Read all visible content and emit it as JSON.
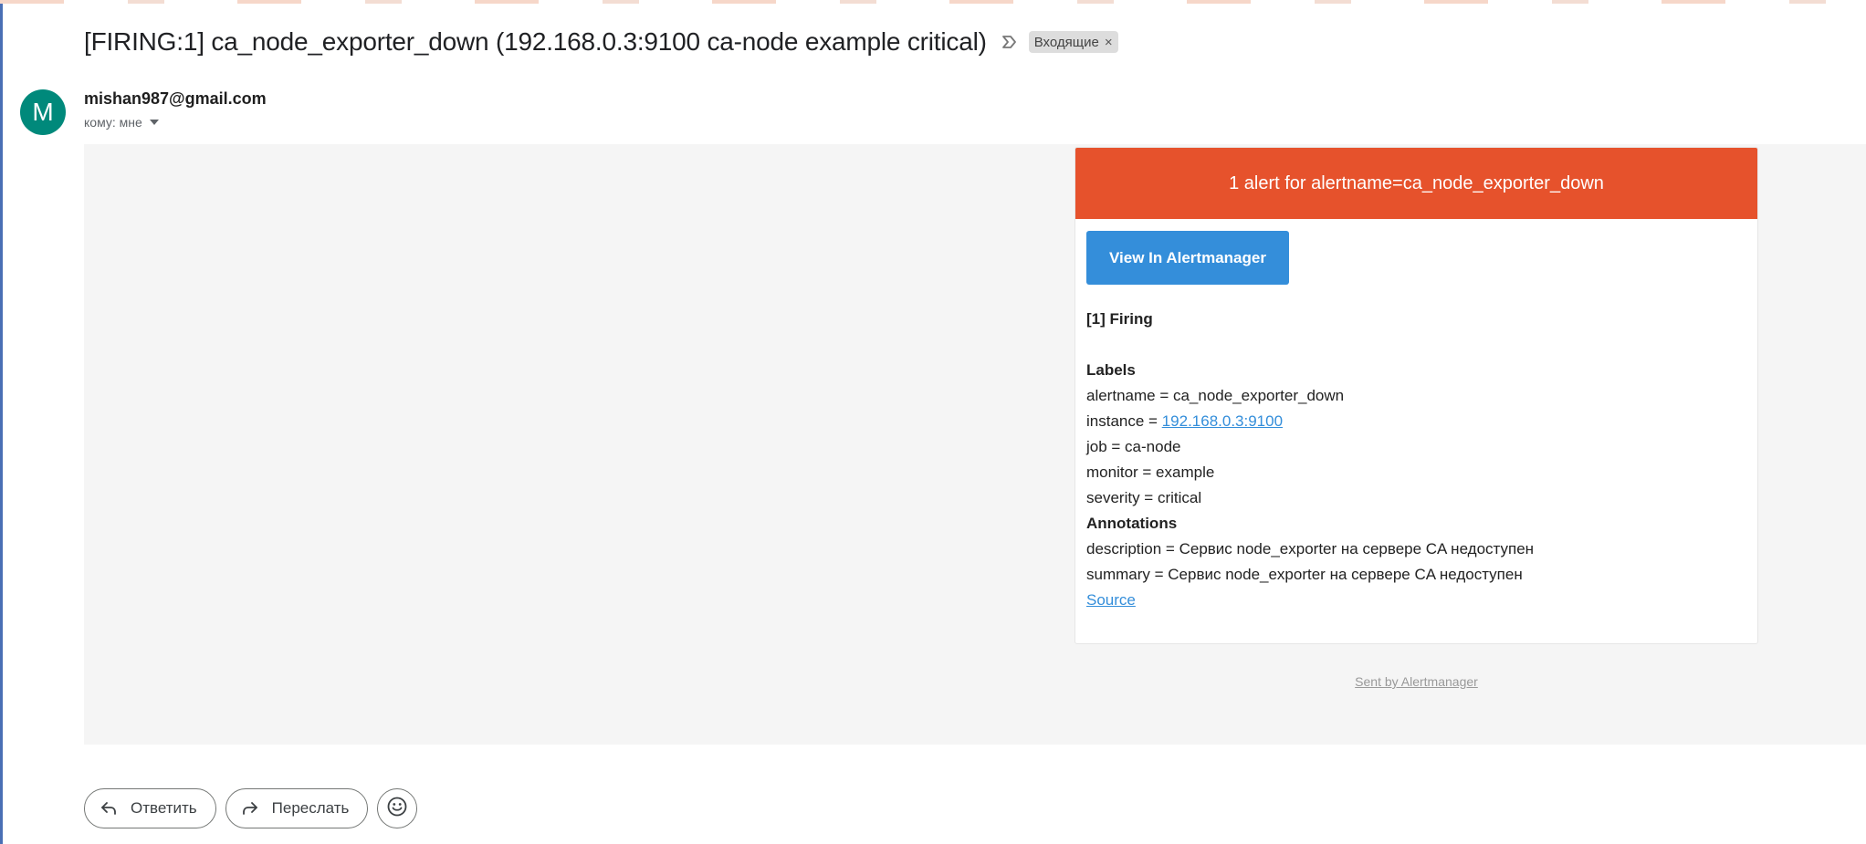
{
  "email": {
    "subject": "[FIRING:1] ca_node_exporter_down (192.168.0.3:9100 ca-node example critical)",
    "label_chip": "Входящие",
    "label_chip_close": "×",
    "sender": "mishan987@gmail.com",
    "avatar_letter": "M",
    "recipient": "кому: мне"
  },
  "alert": {
    "header": "1 alert for alertname=ca_node_exporter_down",
    "button": "View In Alertmanager",
    "firing": "[1] Firing",
    "labels_title": "Labels",
    "labels": {
      "alertname": "alertname = ca_node_exporter_down",
      "instance_prefix": "instance = ",
      "instance_link": "192.168.0.3:9100",
      "job": "job = ca-node",
      "monitor": "monitor = example",
      "severity": "severity = critical"
    },
    "annotations_title": "Annotations",
    "annotations": {
      "description": "description = Сервис node_exporter на сервере CA недоступен",
      "summary": "summary = Сервис node_exporter на сервере CA недоступен"
    },
    "source_link": "Source",
    "footer": "Sent by Alertmanager"
  },
  "actions": {
    "reply": "Ответить",
    "forward": "Переслать"
  },
  "colors": {
    "alert_header": "#e6522c",
    "button": "#348eda",
    "avatar": "#00897b",
    "body_bg": "#f5f5f5"
  },
  "icons": {
    "importance": "importance-marker-icon",
    "reply": "reply-arrow-icon",
    "forward": "forward-arrow-icon",
    "emoji": "smiley-icon",
    "recipient_details": "caret-down-icon"
  }
}
